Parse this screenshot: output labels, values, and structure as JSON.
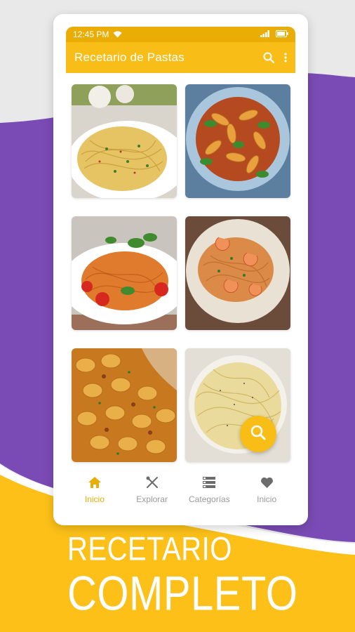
{
  "status_bar": {
    "time": "12:45 PM"
  },
  "app_bar": {
    "title": "Recetario de Pastas",
    "search_icon": "search-icon",
    "menu_icon": "more-vert-icon"
  },
  "recipes": [
    {
      "name": "spaghetti-garlic-oil",
      "color": "#e6c463"
    },
    {
      "name": "fusilli-tomato-basil",
      "color": "#c4562a"
    },
    {
      "name": "spaghetti-cherry-tomatoes",
      "color": "#e07a2c"
    },
    {
      "name": "fettuccine-shrimp-sauce",
      "color": "#dc8a47"
    },
    {
      "name": "shells-meat-sauce",
      "color": "#d89a3a"
    },
    {
      "name": "spaghetti-cacio-pepe",
      "color": "#eadb9c"
    }
  ],
  "fab": {
    "icon": "search-icon"
  },
  "bottom_nav": [
    {
      "label": "Inicio",
      "icon": "home-icon"
    },
    {
      "label": "Explorar",
      "icon": "utensils-icon"
    },
    {
      "label": "Categorías",
      "icon": "list-icon"
    },
    {
      "label": "Inicio",
      "icon": "heart-icon"
    }
  ],
  "promo": {
    "line1": "RECETARIO",
    "line2": "COMPLETO"
  },
  "colors": {
    "accent": "#f9bd17",
    "accent_dark": "#e9ad05",
    "purple": "#7a4bb4",
    "yellow_band": "#fcc018"
  }
}
